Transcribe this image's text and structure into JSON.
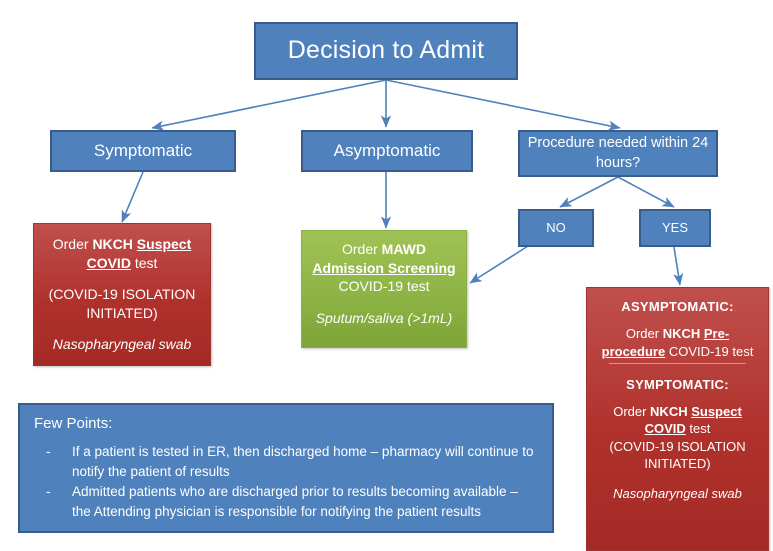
{
  "diagram": {
    "title_node": {
      "label": "Decision to Admit"
    },
    "branch_nodes": [
      {
        "label": "Symptomatic"
      },
      {
        "label": "Asymptomatic"
      },
      {
        "label": "Procedure needed within 24 hours?"
      }
    ],
    "procedure_answers": [
      {
        "label": "NO"
      },
      {
        "label": "YES"
      }
    ],
    "symptomatic_order": {
      "line1_plain": "Order ",
      "line1_bold": "NKCH ",
      "line1_bold_ul": "Suspect",
      "line2_bold_ul": "COVID",
      "line2_plain": " test",
      "isolation_line1": "(COVID-19 ISOLATION",
      "isolation_line2": "INITIATED)",
      "specimen": "Nasopharyngeal swab"
    },
    "asymptomatic_order": {
      "line1_plain": "Order ",
      "line1_bold": "MAWD",
      "line2_bold_ul": "Admission Screening",
      "line3_plain": "COVID-19 test",
      "specimen": "Sputum/saliva (>1mL)"
    },
    "procedure_order": {
      "asymptomatic_header": "ASYMPTOMATIC:",
      "asym_line1_plain": "Order ",
      "asym_line1_bold": "NKCH ",
      "asym_line1_bold_ul": "Pre-",
      "asym_line2_bold_ul": "procedure",
      "asym_line2_plain": " COVID-19 test",
      "symptomatic_header": "SYMPTOMATIC:",
      "sym_line1_plain": "Order ",
      "sym_line1_bold": "NKCH ",
      "sym_line1_bold_ul": "Suspect",
      "sym_line2_bold_ul": "COVID",
      "sym_line2_plain": " test",
      "isolation_line1": "(COVID-19 ISOLATION",
      "isolation_line2": "INITIATED)",
      "specimen": "Nasopharyngeal swab"
    },
    "notes": {
      "title": "Few Points:",
      "bullet_marker": "-",
      "items": [
        "If a patient is tested in ER, then discharged home – pharmacy will continue to notify the patient of results",
        "Admitted patients who are discharged prior to results becoming available – the Attending physician is responsible for notifying the patient results"
      ]
    },
    "colors": {
      "blue_fill": "#4F81BD",
      "blue_border": "#385D8A",
      "red_fill": "#C0504D",
      "green_fill": "#9BBB59",
      "connector": "#4F81BD",
      "divider_rule": "#8FAADC",
      "text": "#FFFFFF"
    }
  }
}
